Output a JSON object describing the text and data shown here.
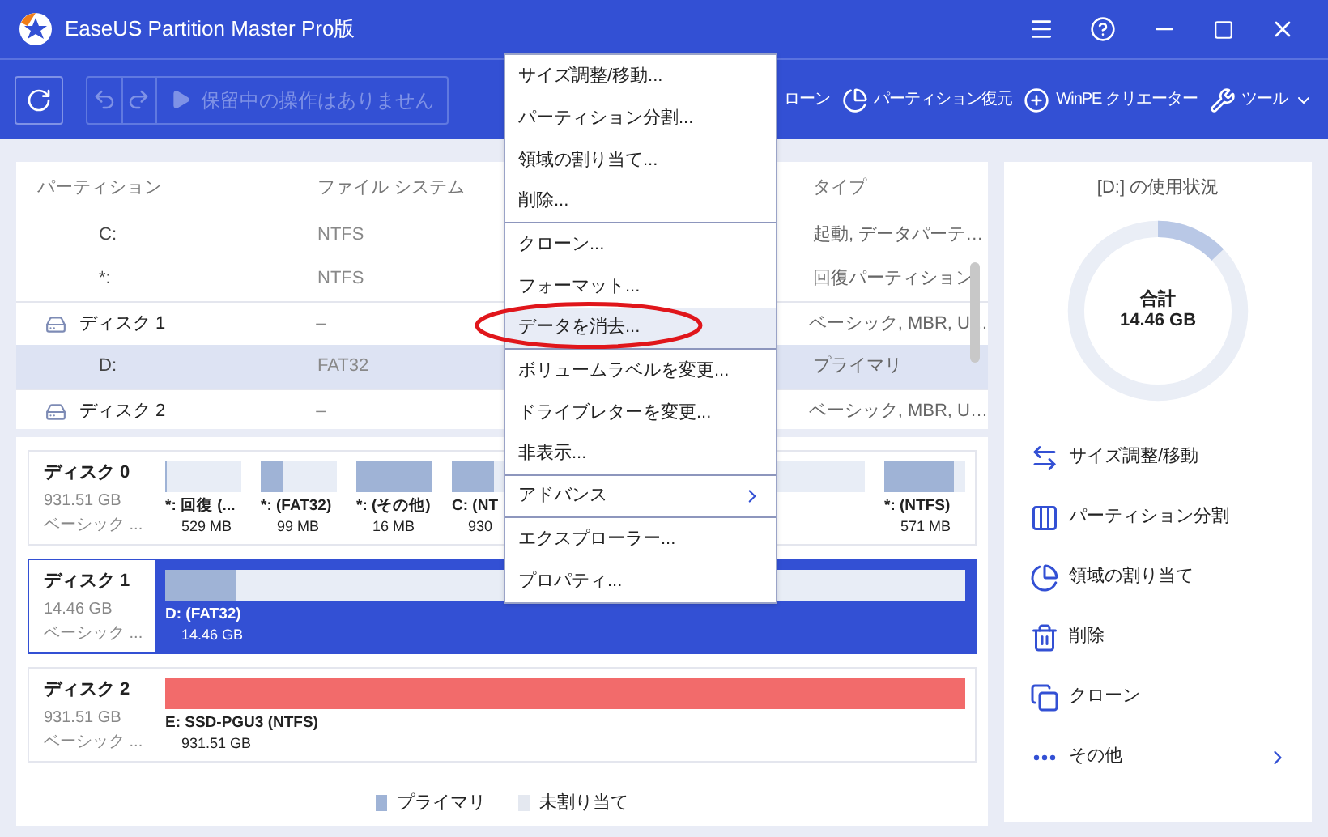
{
  "title_bar": {
    "title": "EaseUS Partition Master Pro版"
  },
  "toolbar": {
    "pending": "保留中の操作はありません",
    "buttons": [
      {
        "label": "ローン",
        "kind": "text"
      },
      {
        "label": "パーティション復元",
        "kind": "restore"
      },
      {
        "label": "WinPE クリエーター",
        "kind": "winpe"
      },
      {
        "label": "ツール",
        "kind": "tools"
      }
    ]
  },
  "partition_table": {
    "columns": [
      "パーティション",
      "ファイル システム",
      "タイプ"
    ],
    "rows": [
      {
        "kind": "partition",
        "partition": "C:",
        "file_system": "NTFS",
        "type": "起動, データパーテ…",
        "selected": false
      },
      {
        "kind": "partition",
        "partition": "*:",
        "file_system": "NTFS",
        "type": "回復パーティション",
        "selected": false
      },
      {
        "kind": "disk",
        "partition": "ディスク 1",
        "file_system": "–",
        "type": "ベーシック, MBR, U…",
        "selected": false
      },
      {
        "kind": "partition",
        "partition": "D:",
        "file_system": "FAT32",
        "type": "プライマリ",
        "selected": true
      },
      {
        "kind": "disk",
        "partition": "ディスク 2",
        "file_system": "–",
        "type": "ベーシック, MBR, U…",
        "selected": false
      }
    ]
  },
  "disk_map": {
    "disks": [
      {
        "name": "ディスク 0",
        "size": "931.51 GB",
        "style": "ベーシック ...",
        "selected": false,
        "partitions": [
          {
            "label": "*: 回復 (...",
            "size": "529 MB",
            "level": 0.02,
            "color": "#9fb3d6"
          },
          {
            "label": "*: (FAT32)",
            "size": "99 MB",
            "level": 0.3,
            "color": "#9fb3d6"
          },
          {
            "label": "*: (その他)",
            "size": "16 MB",
            "level": 1,
            "color": "#9fb3d6"
          },
          {
            "label": "C: (NT",
            "size": "930",
            "level": 0.1,
            "color": "#9fb3d6"
          },
          {
            "label": "*: (NTFS)",
            "size": "571 MB",
            "level": 0.85,
            "color": "#9fb3d6"
          }
        ]
      },
      {
        "name": "ディスク 1",
        "size": "14.46 GB",
        "style": "ベーシック ...",
        "selected": true,
        "partitions": [
          {
            "label": "D: (FAT32)",
            "size": "14.46 GB",
            "level": 0.09,
            "color": "#9fb3d6"
          }
        ]
      },
      {
        "name": "ディスク 2",
        "size": "931.51 GB",
        "style": "ベーシック ...",
        "selected": false,
        "partitions": [
          {
            "label": "E: SSD-PGU3 (NTFS)",
            "size": "931.51 GB",
            "level": 1,
            "color": "#f26b6b"
          }
        ]
      }
    ],
    "legend": [
      {
        "label": "プライマリ",
        "color": "#9fb3d6"
      },
      {
        "label": "未割り当て",
        "color": "#e4e8f0"
      }
    ]
  },
  "usage": {
    "title": "[D:] の使用状況",
    "total_label": "合計",
    "total": "14.46 GB",
    "level": 0.13,
    "actions": [
      {
        "label": "サイズ調整/移動",
        "kind": "resize",
        "has_submenu": false
      },
      {
        "label": "パーティション分割",
        "kind": "split",
        "has_submenu": false
      },
      {
        "label": "領域の割り当て",
        "kind": "allocate",
        "has_submenu": false
      },
      {
        "label": "削除",
        "kind": "delete",
        "has_submenu": false
      },
      {
        "label": "クローン",
        "kind": "clone",
        "has_submenu": false
      },
      {
        "label": "その他",
        "kind": "more",
        "has_submenu": true
      }
    ]
  },
  "context_menu": {
    "items": [
      {
        "label": "サイズ調整/移動...",
        "highlighted": false,
        "divider_after": false,
        "has_submenu": false,
        "circled": false
      },
      {
        "label": "パーティション分割...",
        "highlighted": false,
        "divider_after": false,
        "has_submenu": false,
        "circled": false
      },
      {
        "label": "領域の割り当て...",
        "highlighted": false,
        "divider_after": false,
        "has_submenu": false,
        "circled": false
      },
      {
        "label": "削除...",
        "highlighted": false,
        "divider_after": true,
        "has_submenu": false,
        "circled": false
      },
      {
        "label": "クローン...",
        "highlighted": false,
        "divider_after": false,
        "has_submenu": false,
        "circled": false
      },
      {
        "label": "フォーマット...",
        "highlighted": false,
        "divider_after": false,
        "has_submenu": false,
        "circled": false
      },
      {
        "label": "データを消去...",
        "highlighted": true,
        "divider_after": true,
        "has_submenu": false,
        "circled": true
      },
      {
        "label": "ボリュームラベルを変更...",
        "highlighted": false,
        "divider_after": false,
        "has_submenu": false,
        "circled": false
      },
      {
        "label": "ドライブレターを変更...",
        "highlighted": false,
        "divider_after": false,
        "has_submenu": false,
        "circled": false
      },
      {
        "label": "非表示...",
        "highlighted": false,
        "divider_after": true,
        "has_submenu": false,
        "circled": false
      },
      {
        "label": "アドバンス",
        "highlighted": false,
        "divider_after": true,
        "has_submenu": true,
        "circled": false
      },
      {
        "label": "エクスプローラー...",
        "highlighted": false,
        "divider_after": false,
        "has_submenu": false,
        "circled": false
      },
      {
        "label": "プロパティ...",
        "highlighted": false,
        "divider_after": false,
        "has_submenu": false,
        "circled": false
      }
    ]
  }
}
